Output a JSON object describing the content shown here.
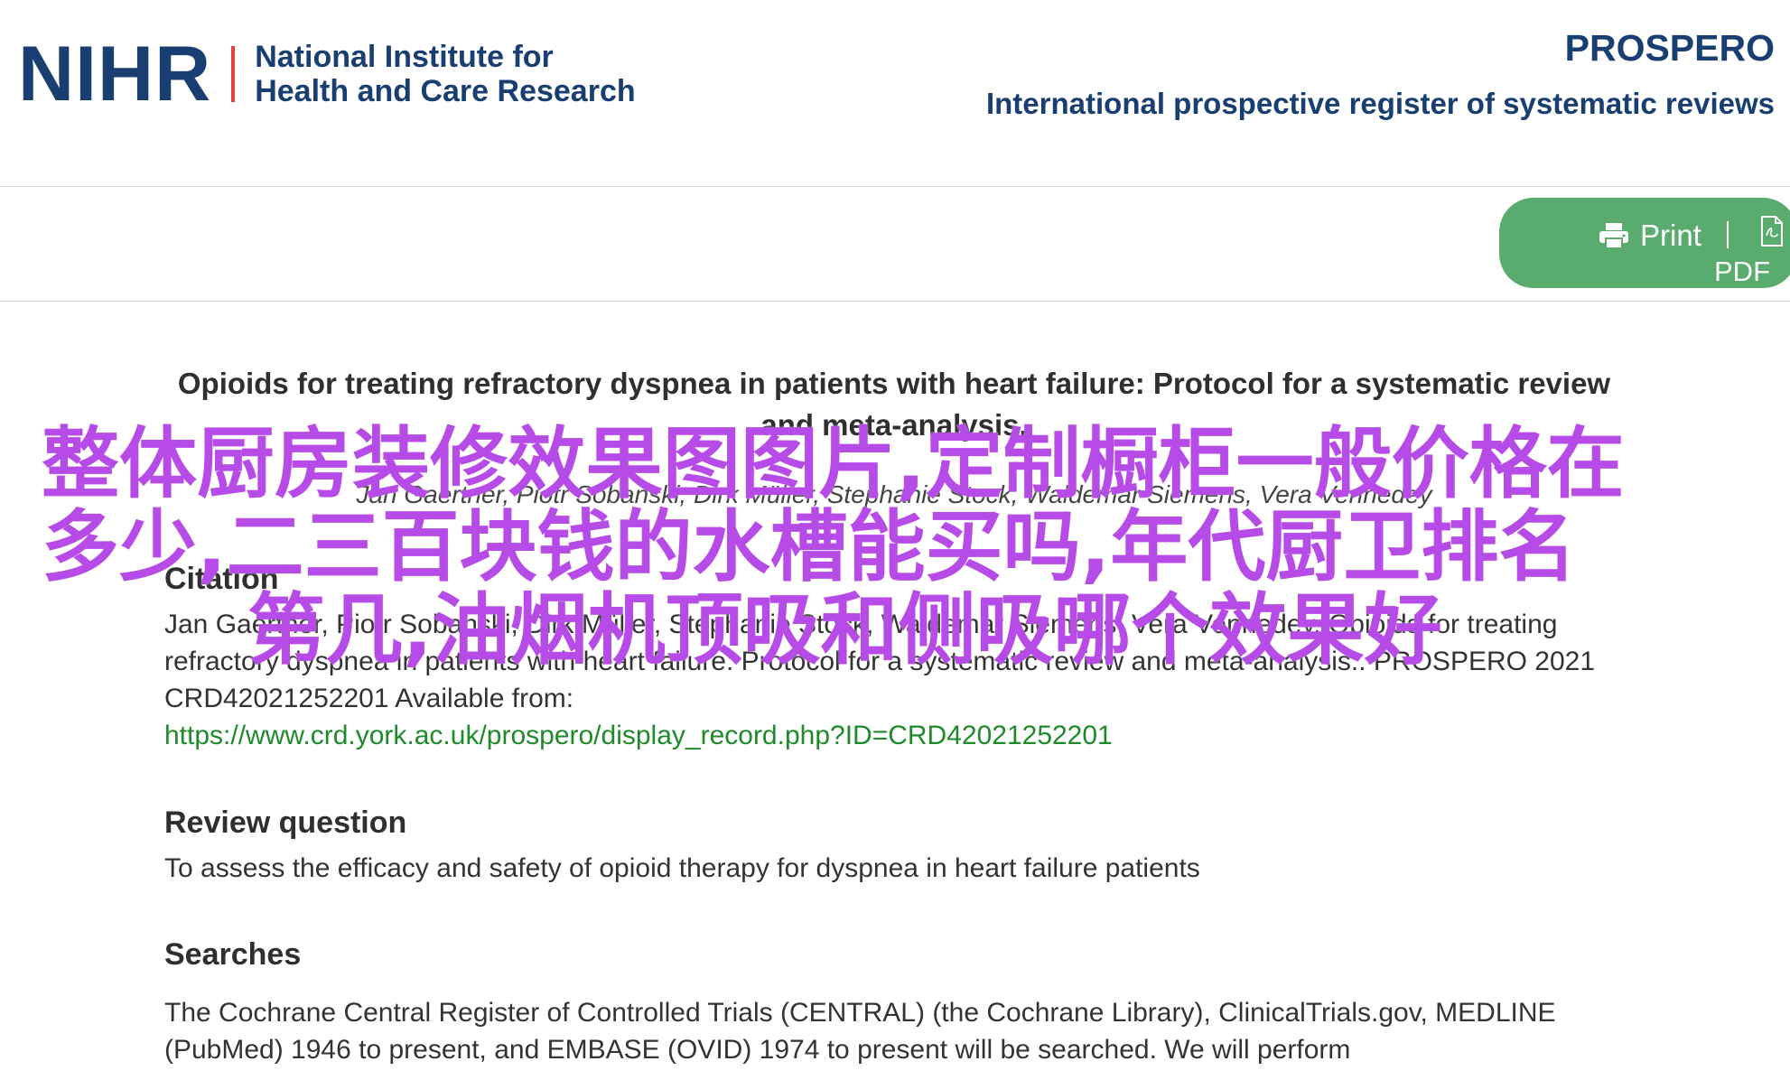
{
  "header": {
    "logo_abbrev": "NIHR",
    "logo_name_line1": "National Institute for",
    "logo_name_line2": "Health and Care Research",
    "site_title": "PROSPERO",
    "site_subtitle": "International prospective register of systematic reviews"
  },
  "toolbar": {
    "print_label": "Print",
    "separator": "|",
    "pdf_label": "PDF",
    "print_icon": "printer-icon",
    "pdf_icon": "pdf-file-icon",
    "accent_color": "#5aac6e"
  },
  "record": {
    "title": "Opioids for treating refractory dyspnea in patients with heart failure: Protocol for a systematic review and meta-analysis.",
    "authors": "Jan Gaertner, Piotr Sobanski, Dirk Müller, Stephanie Stock, Waldemar Siemens, Vera Vennedey"
  },
  "sections": {
    "citation": {
      "heading": "Citation",
      "text": "Jan Gaertner, Piotr Sobanski, Dirk Müller, Stephanie Stock, Waldemar Siemens, Vera Vennedey. Opioids for treating refractory dyspnea in patients with heart failure: Protocol for a systematic review and meta-analysis.. PROSPERO 2021 CRD42021252201 Available from:",
      "link": "https://www.crd.york.ac.uk/prospero/display_record.php?ID=CRD42021252201"
    },
    "review_question": {
      "heading": "Review question",
      "text": "To assess the efficacy and safety of opioid therapy for dyspnea in heart failure patients"
    },
    "searches": {
      "heading": "Searches",
      "text": "The Cochrane Central Register of Controlled Trials (CENTRAL) (the Cochrane Library), ClinicalTrials.gov, MEDLINE (PubMed) 1946 to present, and EMBASE (OVID) 1974 to present will be searched. We will perform"
    }
  },
  "overlay": {
    "line1": "整体厨房装修效果图图片,定制橱柜一般价格在",
    "line2": "多少,二三百块钱的水槽能买吗,年代厨卫排名",
    "line3": "第几,油烟机顶吸和侧吸哪个效果好",
    "color": "#b64be8"
  },
  "colors": {
    "brand_navy": "#193e72",
    "brand_red": "#e8413c",
    "link_green": "#1f8a2a"
  }
}
